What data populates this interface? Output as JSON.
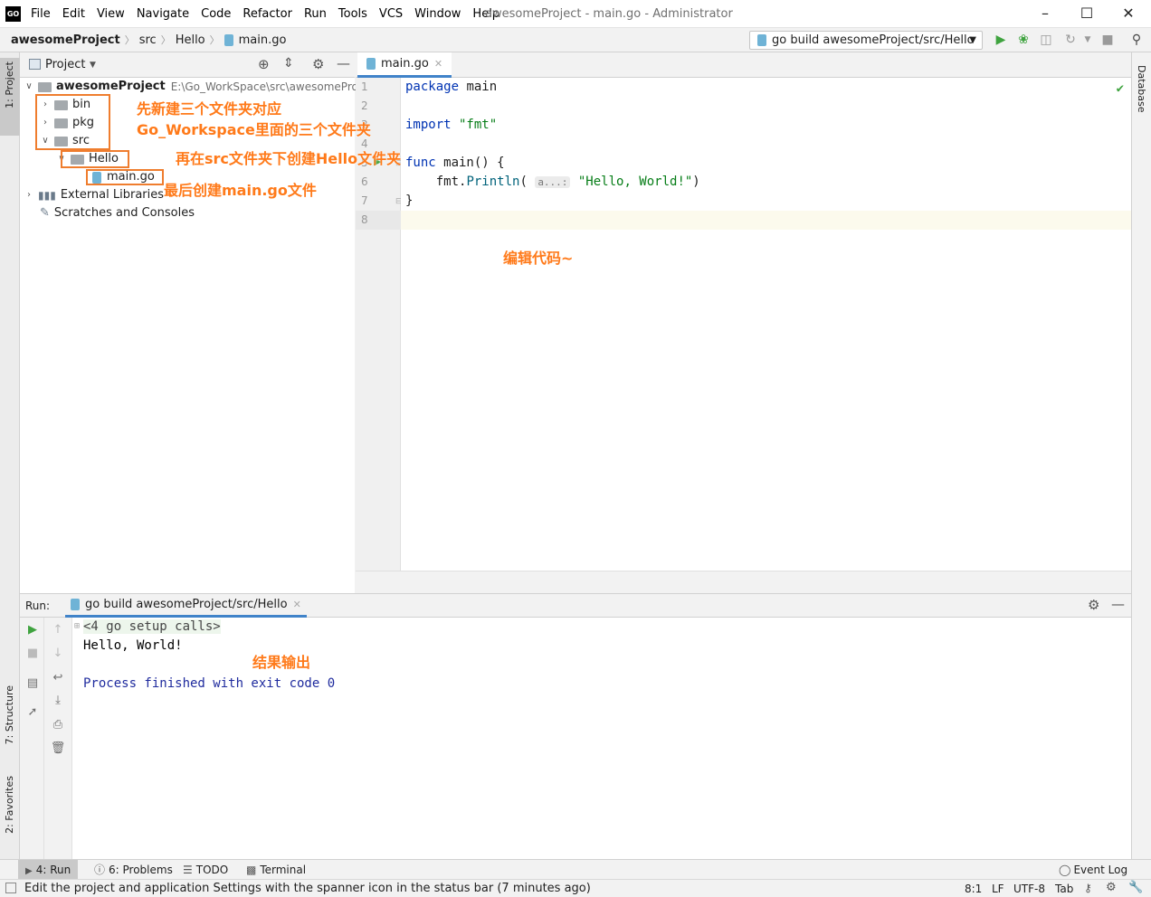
{
  "app": {
    "logo": "GO",
    "window_title": "awesomeProject - main.go - Administrator",
    "menu": [
      "File",
      "Edit",
      "View",
      "Navigate",
      "Code",
      "Refactor",
      "Run",
      "Tools",
      "VCS",
      "Window",
      "Help"
    ]
  },
  "navbar": {
    "breadcrumb": [
      "awesomeProject",
      "src",
      "Hello",
      "main.go"
    ],
    "run_config": "go build awesomeProject/src/Hello"
  },
  "left_stripe": {
    "project": "1: Project",
    "structure": "7: Structure",
    "favorites": "2: Favorites"
  },
  "right_stripe": {
    "database": "Database"
  },
  "project": {
    "header": "Project",
    "root": "awesomeProject",
    "root_path": "E:\\Go_WorkSpace\\src\\awesomeProjec",
    "folders": [
      "bin",
      "pkg",
      "src"
    ],
    "subfolder": "Hello",
    "file": "main.go",
    "external_libraries": "External Libraries",
    "scratches": "Scratches and Consoles"
  },
  "editor": {
    "tab": "main.go",
    "line_numbers": [
      "1",
      "2",
      "3",
      "4",
      "5",
      "6",
      "7",
      "8"
    ],
    "code": {
      "l1_kw": "package",
      "l1_rest": " main",
      "l3_kw": "import",
      "l3_str": " \"fmt\"",
      "l5_kw": "func",
      "l5_rest": " main() {",
      "l6_pre": "    fmt.",
      "l6_fn": "Println",
      "l6_open": "( ",
      "l6_hint": "a...:",
      "l6_str": " \"Hello, World!\"",
      "l6_close": ")",
      "l7": "}"
    }
  },
  "run": {
    "label": "Run:",
    "tab": "go build awesomeProject/src/Hello",
    "console": {
      "setup": "<4 go setup calls>",
      "output": "Hello, World!",
      "finished": "Process finished with exit code 0"
    }
  },
  "tool_tabs": {
    "run": "4: Run",
    "problems": "6: Problems",
    "todo": "TODO",
    "terminal": "Terminal",
    "event_log": "Event Log"
  },
  "status": {
    "message": "Edit the project and application Settings with the spanner icon in the status bar (7 minutes ago)",
    "position": "8:1",
    "line_sep": "LF",
    "encoding": "UTF-8",
    "indent": "Tab"
  },
  "annotations": {
    "a1_line1": "先新建三个文件夹对应",
    "a1_line2": "Go_Workspace里面的三个文件夹",
    "a2": "再在src文件夹下创建Hello文件夹",
    "a3": "最后创建main.go文件",
    "a4": "编辑代码~",
    "a5": "结果输出"
  },
  "colors": {
    "annotation": "#ff7a1a",
    "annotation_box": "#ef7d2e",
    "run_green": "#3fa33f",
    "tab_underline": "#4083c9"
  }
}
